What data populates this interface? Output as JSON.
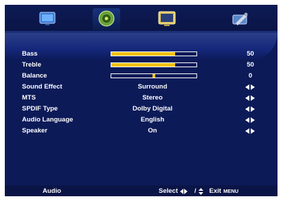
{
  "tabs": [
    {
      "icon": "picture-icon"
    },
    {
      "icon": "audio-icon",
      "active": true
    },
    {
      "icon": "tv-icon"
    },
    {
      "icon": "setup-icon"
    }
  ],
  "menu": {
    "items": [
      {
        "label": "Bass",
        "type": "slider",
        "level": 0.75,
        "value": "50"
      },
      {
        "label": "Treble",
        "type": "slider",
        "level": 0.75,
        "value": "50"
      },
      {
        "label": "Balance",
        "type": "slider",
        "level": 0.5,
        "value": "0"
      },
      {
        "label": "Sound Effect",
        "value": "Surround"
      },
      {
        "label": "MTS",
        "value": "Stereo"
      },
      {
        "label": "SPDIF Type",
        "value": "Dolby Digital"
      },
      {
        "label": "Audio Language",
        "value": "English"
      },
      {
        "label": "Speaker",
        "value": "On"
      }
    ]
  },
  "footer": {
    "section": "Audio",
    "select_label": "Select",
    "exit_label": "Exit",
    "menu_label": "MENU"
  },
  "colors": {
    "background": "#0e1d5e",
    "accent": "#f4c316",
    "text": "#ffffff"
  }
}
